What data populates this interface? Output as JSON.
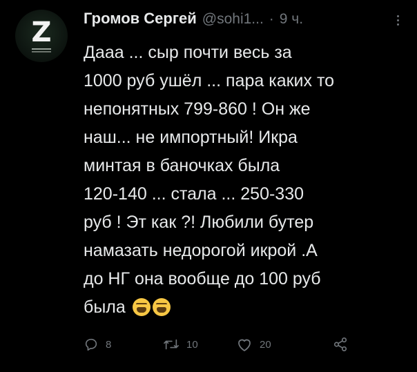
{
  "tweet": {
    "author_name": "Громов Сергей",
    "handle": "@sohi1...",
    "dot": "·",
    "time": "9 ч.",
    "text": "Дааа ... сыр почти весь за\n1000 руб ушёл ... пара каких то\nнепонятных 799-860 ! Он же\nнаш... не импортный! Икра\nминтая в баночках была\n120-140 ... стала ... 250-330\nруб ! Эт как ?! Любили бутер\nнамазать недорогой икрой .А\nдо НГ она вообще до 100 руб\nбыла",
    "avatar_letter": "Z",
    "emojis": [
      "weary-face-emoji",
      "weary-face-emoji"
    ]
  },
  "actions": {
    "reply_count": "8",
    "retweet_count": "10",
    "like_count": "20"
  },
  "colors": {
    "background": "#000000",
    "text": "#e7e9ea",
    "muted": "#71767b"
  }
}
